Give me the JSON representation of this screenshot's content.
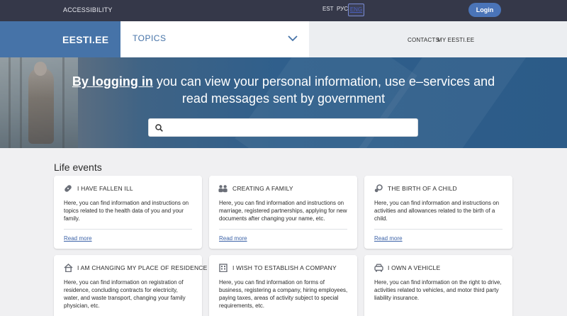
{
  "topbar": {
    "accessibility": "ACCESSIBILITY",
    "languages": [
      "EST",
      "РУС",
      "ENG"
    ],
    "login": "Login"
  },
  "nav": {
    "logo": "EESTI.EE",
    "topics": "TOPICS",
    "contacts": "CONTACTS",
    "my_eesti": "MY EESTI.EE"
  },
  "hero": {
    "link_text": "By logging in",
    "text": " you can view your personal information, use e–services and read messages sent by government",
    "search_placeholder": ""
  },
  "life_events": {
    "title": "Life events",
    "read_more": "Read more",
    "cards": [
      {
        "title": "I HAVE FALLEN ILL",
        "icon": "bandage-icon",
        "text": "Here, you can find information and instructions on topics related to the health data of you and your family."
      },
      {
        "title": "CREATING A FAMILY",
        "icon": "family-icon",
        "text": "Here, you can find information and instructions on marriage, registered partnerships, applying for new documents after changing your name, etc."
      },
      {
        "title": "THE BIRTH OF A CHILD",
        "icon": "pacifier-icon",
        "text": "Here, you can find information and instructions on activities and allowances related to the birth of a child."
      },
      {
        "title": "I AM CHANGING MY PLACE OF RESIDENCE",
        "icon": "house-icon",
        "text": "Here, you can find information on registration of residence, concluding contracts for electricity, water, and waste transport, changing your family physician, etc."
      },
      {
        "title": "I WISH TO ESTABLISH A COMPANY",
        "icon": "building-icon",
        "text": "Here, you can find information on forms of business, registering a company, hiring employees, paying taxes, areas of activity subject to special requirements, etc."
      },
      {
        "title": "I OWN A VEHICLE",
        "icon": "car-icon",
        "text": "Here, you can find information on the right to drive, activities related to vehicles, and motor third party liability insurance."
      }
    ]
  },
  "colors": {
    "topbar": "#353849",
    "brand": "#4673a8",
    "link": "#3e64a8"
  }
}
